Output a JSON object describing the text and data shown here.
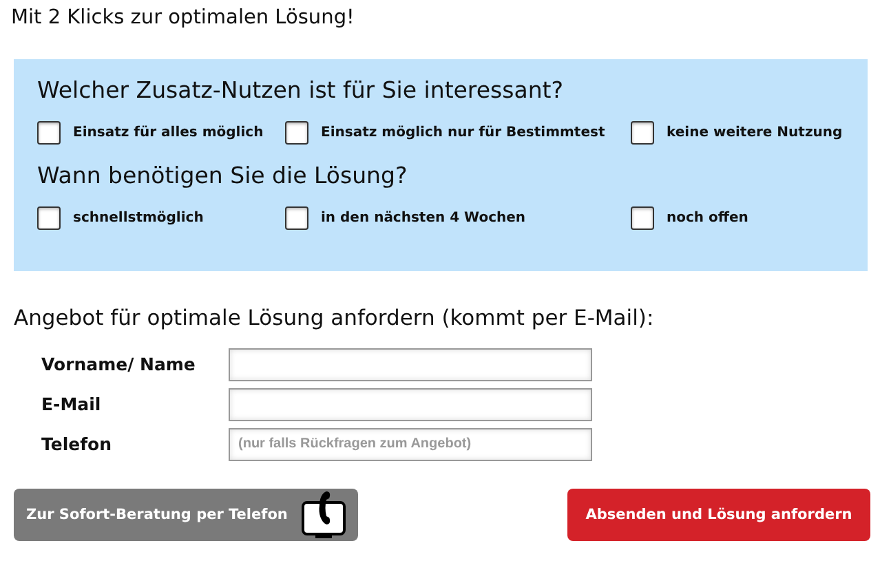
{
  "title": "Mit 2 Klicks zur optimalen Lösung!",
  "questions": [
    {
      "question": "Welcher Zusatz-Nutzen ist für Sie interessant?",
      "options": [
        {
          "label": "Einsatz für alles möglich",
          "checked": false
        },
        {
          "label": "Einsatz möglich nur für Bestimmtest",
          "checked": false
        },
        {
          "label": "keine weitere Nutzung",
          "checked": false
        }
      ]
    },
    {
      "question": "Wann benötigen Sie die Lösung?",
      "options": [
        {
          "label": "schnellstmöglich",
          "checked": false
        },
        {
          "label": "in den nächsten 4 Wochen",
          "checked": false
        },
        {
          "label": "noch offen",
          "checked": false
        }
      ]
    }
  ],
  "form_heading": "Angebot für optimale Lösung anfordern (kommt per E-Mail):",
  "fields": [
    {
      "label": "Vorname/ Name"
    },
    {
      "label": "E-Mail"
    },
    {
      "label": "Telefon",
      "placeholder": "(nur falls Rückfragen zum Angebot)"
    }
  ],
  "phone_button": "Zur Sofort-Beratung per Telefon",
  "submit_button": "Absenden und Lösung anfordern"
}
